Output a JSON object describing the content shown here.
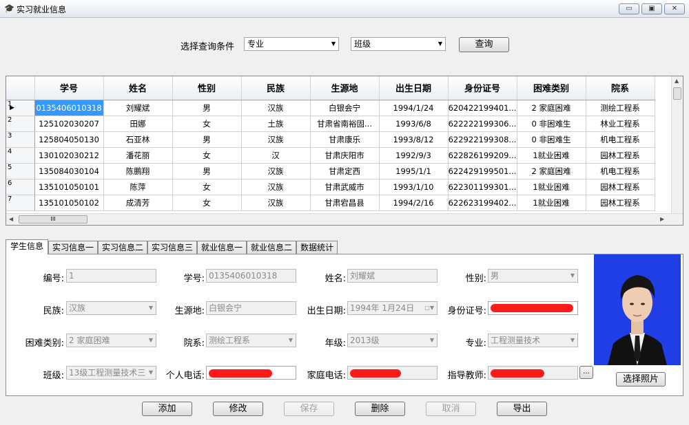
{
  "window": {
    "title": "实习就业信息",
    "minimize": "▭",
    "maximize": "▣",
    "close": "✕"
  },
  "query": {
    "label": "选择查询条件",
    "field1": "专业",
    "field2": "班级",
    "button": "查询"
  },
  "grid": {
    "columns": [
      "学号",
      "姓名",
      "性别",
      "民族",
      "生源地",
      "出生日期",
      "身份证号",
      "困难类别",
      "院系"
    ],
    "rows": [
      {
        "n": "1",
        "id": "0135406010318",
        "name": "刘耀斌",
        "sex": "男",
        "eth": "汉族",
        "origin": "白银会宁",
        "birth": "1994/1/24",
        "idno": "620422199401...",
        "diff": "2 家庭困难",
        "dept": "测绘工程系"
      },
      {
        "n": "2",
        "id": "125102030207",
        "name": "田娜",
        "sex": "女",
        "eth": "土族",
        "origin": "甘肃省南裕固...",
        "birth": "1993/6/8",
        "idno": "622222199306...",
        "diff": "0 非困难生",
        "dept": "林业工程系"
      },
      {
        "n": "3",
        "id": "125804050130",
        "name": "石亚林",
        "sex": "男",
        "eth": "汉族",
        "origin": "甘肃康乐",
        "birth": "1993/8/12",
        "idno": "622922199308...",
        "diff": "0 非困难生",
        "dept": "机电工程系"
      },
      {
        "n": "4",
        "id": "130102030212",
        "name": "潘花丽",
        "sex": "女",
        "eth": "汉",
        "origin": "甘肃庆阳市",
        "birth": "1992/9/3",
        "idno": "622826199209...",
        "diff": "1就业困难",
        "dept": "园林工程系"
      },
      {
        "n": "5",
        "id": "135084030104",
        "name": "陈鹏翔",
        "sex": "男",
        "eth": "汉族",
        "origin": "甘肃定西",
        "birth": "1995/1/1",
        "idno": "622429199501...",
        "diff": "2 家庭困难",
        "dept": "机电工程系"
      },
      {
        "n": "6",
        "id": "135101050101",
        "name": "陈萍",
        "sex": "女",
        "eth": "汉族",
        "origin": "甘肃武威市",
        "birth": "1993/1/10",
        "idno": "622301199301...",
        "diff": "1就业困难",
        "dept": "园林工程系"
      },
      {
        "n": "7",
        "id": "135101050102",
        "name": "成清芳",
        "sex": "女",
        "eth": "汉族",
        "origin": "甘肃宕昌县",
        "birth": "1994/2/16",
        "idno": "622623199402...",
        "diff": "1就业困难",
        "dept": "园林工程系"
      }
    ],
    "hthumb": "III"
  },
  "tabs": [
    "学生信息",
    "实习信息一",
    "实习信息二",
    "实习信息三",
    "就业信息一",
    "就业信息二",
    "数据统计"
  ],
  "form": {
    "num_label": "编号:",
    "num": "1",
    "sid_label": "学号:",
    "sid": "0135406010318",
    "name_label": "姓名:",
    "name": "刘耀斌",
    "sex_label": "性别:",
    "sex": "男",
    "eth_label": "民族:",
    "eth": "汉族",
    "origin_label": "生源地:",
    "origin": "白银会宁",
    "birth_label": "出生日期:",
    "birth": "1994年  1月24日",
    "idno_label": "身份证号:",
    "diff_label": "困难类别:",
    "diff": "2 家庭困难",
    "dept_label": "院系:",
    "dept": "测绘工程系",
    "grade_label": "年级:",
    "grade": "2013级",
    "major_label": "专业:",
    "major": "工程测量技术",
    "class_label": "班级:",
    "class": "13级工程测量技术三",
    "phone_label": "个人电话:",
    "home_label": "家庭电话:",
    "teacher_label": "指导教师:",
    "ellipsis": "...",
    "photo_button": "选择照片"
  },
  "actions": {
    "add": "添加",
    "edit": "修改",
    "save": "保存",
    "delete": "删除",
    "cancel": "取消",
    "export": "导出"
  }
}
